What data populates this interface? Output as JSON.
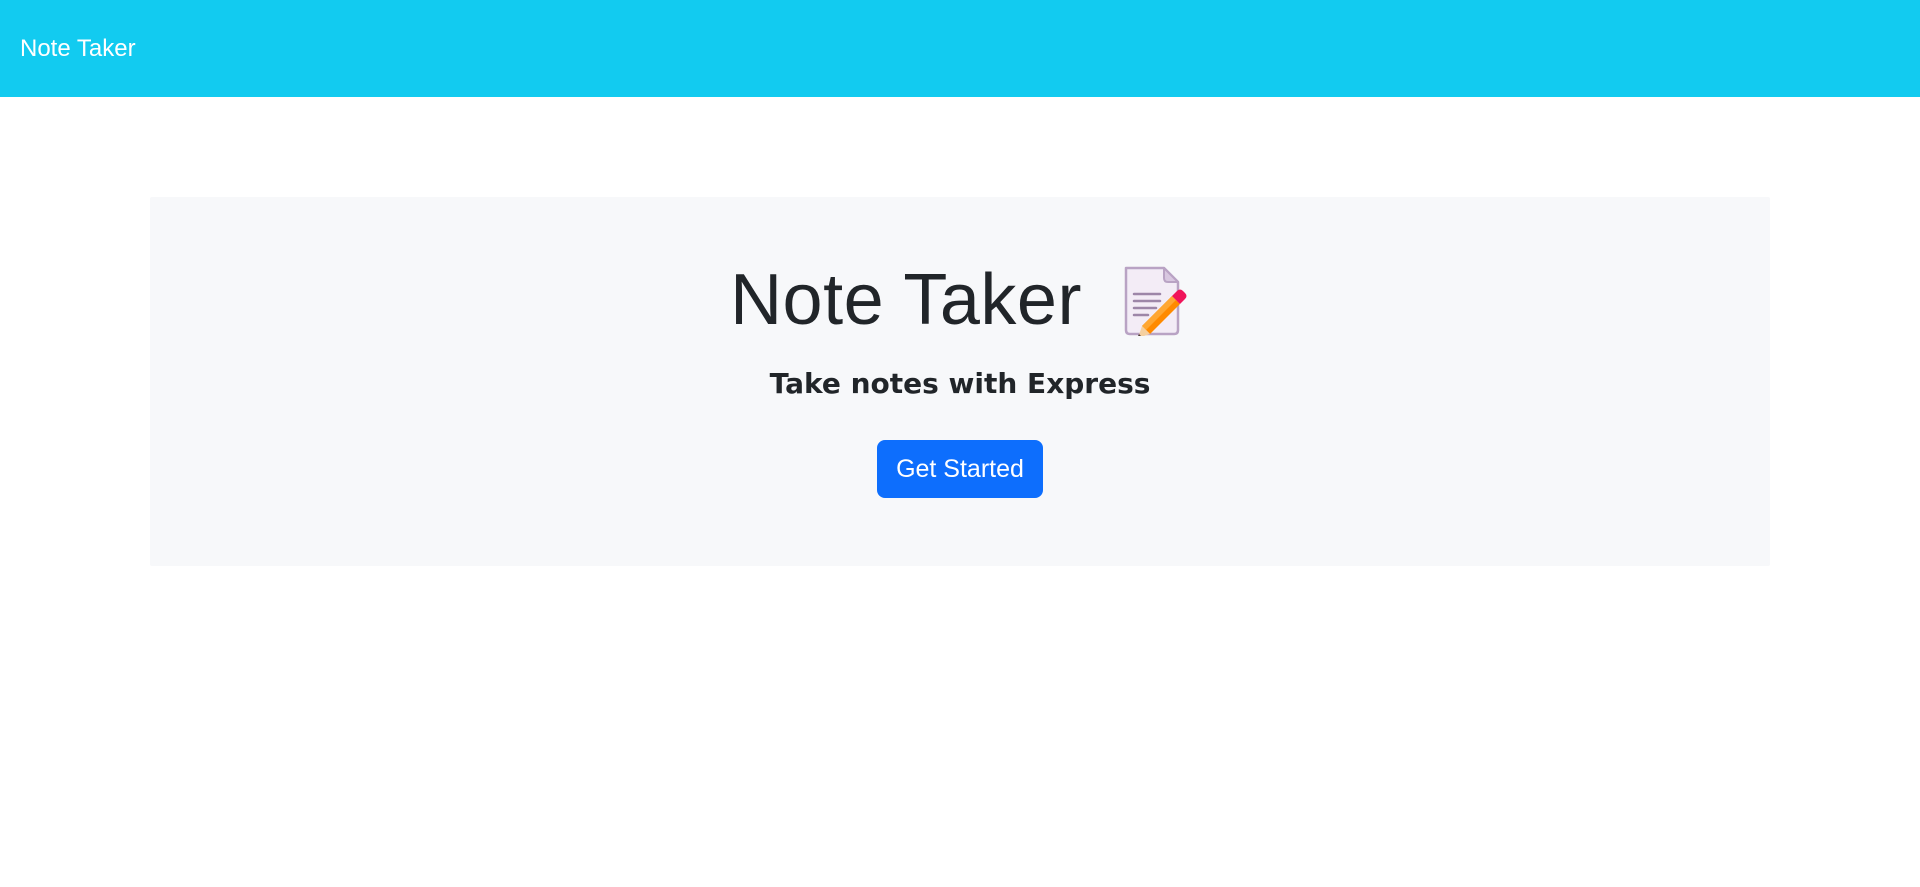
{
  "navbar": {
    "brand": "Note Taker",
    "background_color": "#12cbf0"
  },
  "hero": {
    "title": "Note Taker",
    "title_icon": "memo-icon",
    "subtitle": "Take notes with Express",
    "cta_label": "Get Started",
    "cta_color": "#0d6efd",
    "panel_color": "#f7f8fa"
  }
}
